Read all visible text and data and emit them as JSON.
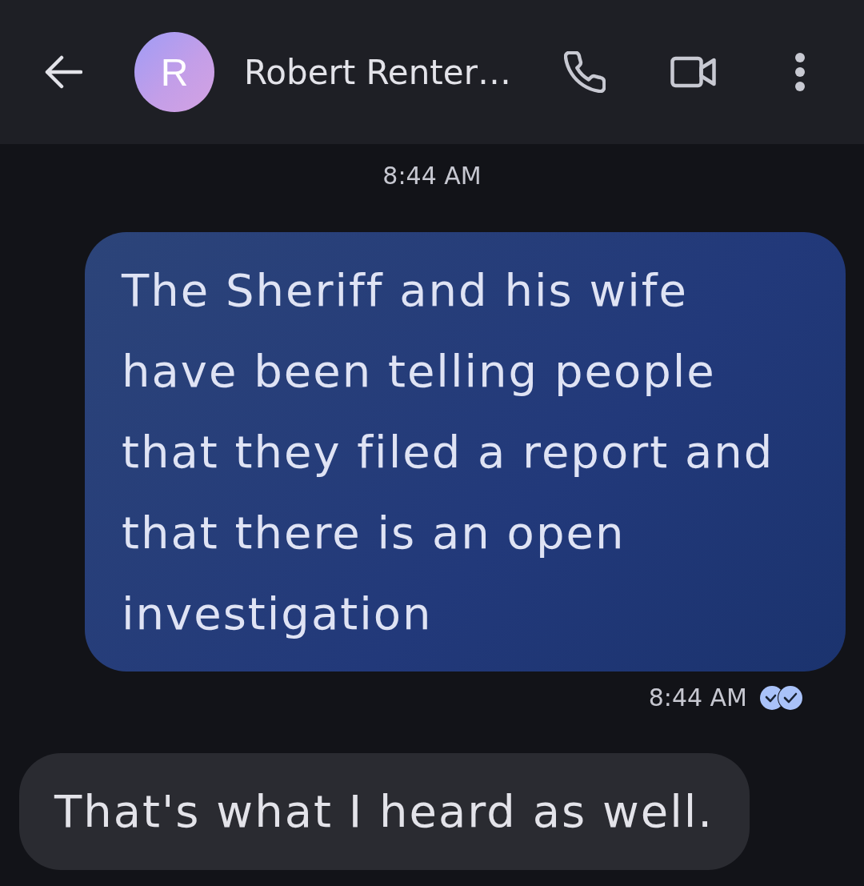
{
  "header": {
    "avatar_letter": "R",
    "contact_name": "Robert Renter…"
  },
  "messages": [
    {
      "kind": "timestamp",
      "text": "8:44 AM"
    },
    {
      "kind": "outgoing",
      "text": "The Sheriff and his wife have been telling people that they filed a report and that there is an open investigation",
      "time": "8:44 AM",
      "read": true
    },
    {
      "kind": "incoming",
      "text": "That's what I heard as well."
    }
  ]
}
